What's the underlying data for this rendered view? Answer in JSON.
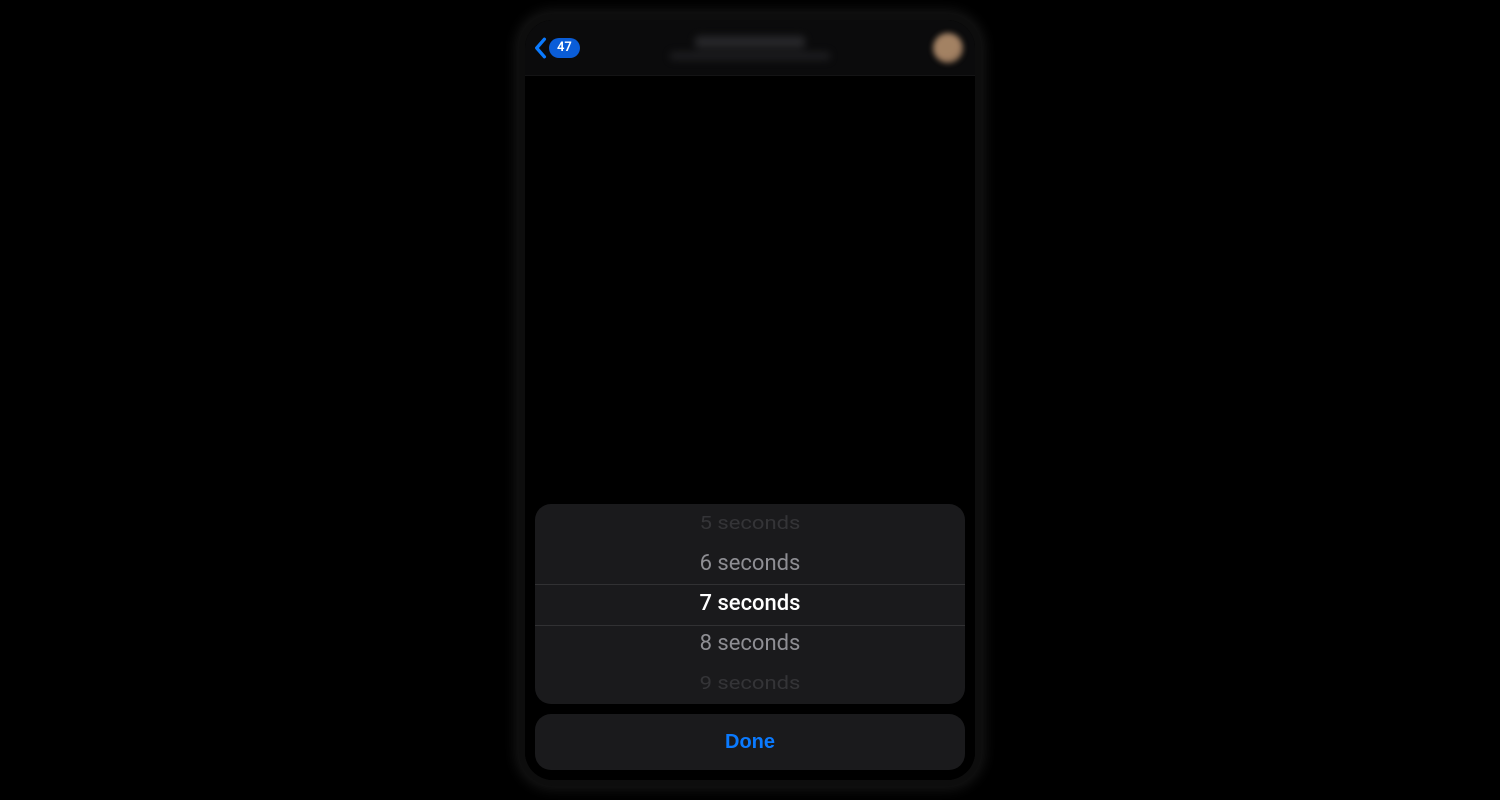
{
  "colors": {
    "accent": "#0a7aff",
    "sheet_bg": "#1a1a1c",
    "text_muted": "#8e8e93"
  },
  "navbar": {
    "back_badge": "47"
  },
  "picker": {
    "options": [
      "5 seconds",
      "6 seconds",
      "7 seconds",
      "8 seconds",
      "9 seconds"
    ],
    "selected_index": 2
  },
  "actions": {
    "done_label": "Done"
  }
}
